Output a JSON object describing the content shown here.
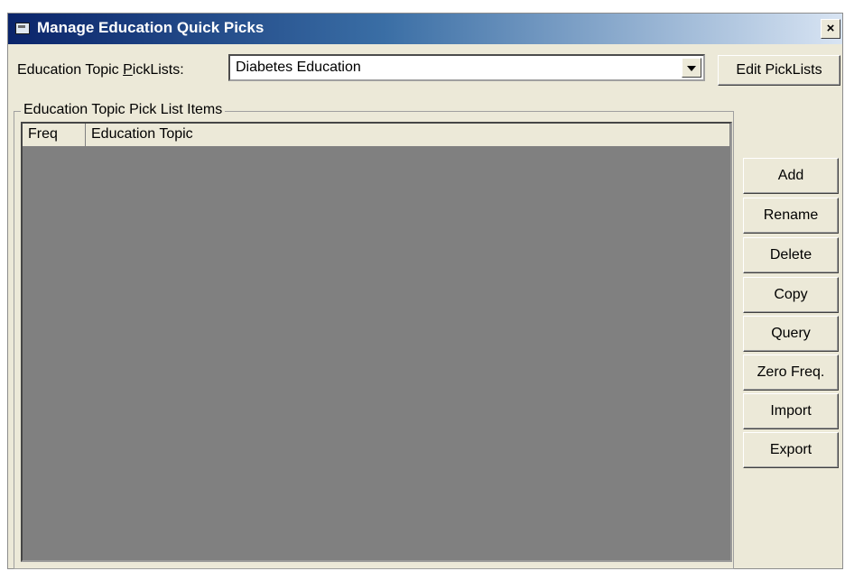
{
  "window": {
    "title": "Manage Education Quick Picks",
    "close_label": "×"
  },
  "picklist_row": {
    "label_prefix": "Education Topic ",
    "label_accel": "P",
    "label_suffix": "ickLists:",
    "selected_value": "Diabetes Education",
    "edit_button_label": "Edit PickLists"
  },
  "group": {
    "label": "Education Topic Pick List Items",
    "columns": [
      "Freq",
      "Education Topic"
    ],
    "rows": []
  },
  "side_buttons": [
    "Add",
    "Rename",
    "Delete",
    "Copy",
    "Query",
    "Zero Freq.",
    "Import",
    "Export"
  ],
  "colors": {
    "title_gradient_start": "#0a246a",
    "dialog_bg": "#ece9d8",
    "list_bg": "#808080"
  }
}
